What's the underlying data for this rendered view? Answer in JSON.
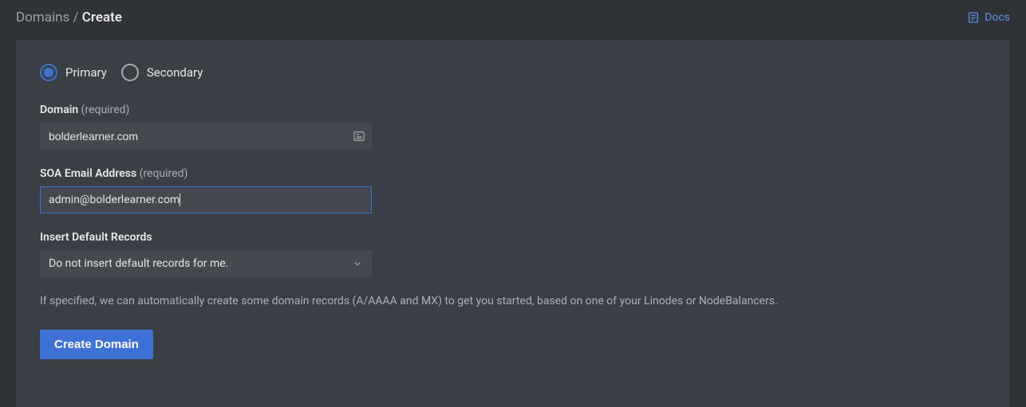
{
  "breadcrumb": {
    "parent": "Domains",
    "current": "Create"
  },
  "docs_label": "Docs",
  "radio": {
    "primary_label": "Primary",
    "secondary_label": "Secondary",
    "selected": "primary"
  },
  "domain_field": {
    "label": "Domain",
    "required_text": "(required)",
    "value": "bolderlearner.com"
  },
  "soa_field": {
    "label": "SOA Email Address",
    "required_text": "(required)",
    "value": "admin@bolderlearner.com"
  },
  "default_records": {
    "label": "Insert Default Records",
    "selected": "Do not insert default records for me.",
    "help": "If specified, we can automatically create some domain records (A/AAAA and MX) to get you started, based on one of your Linodes or NodeBalancers."
  },
  "submit_label": "Create Domain"
}
